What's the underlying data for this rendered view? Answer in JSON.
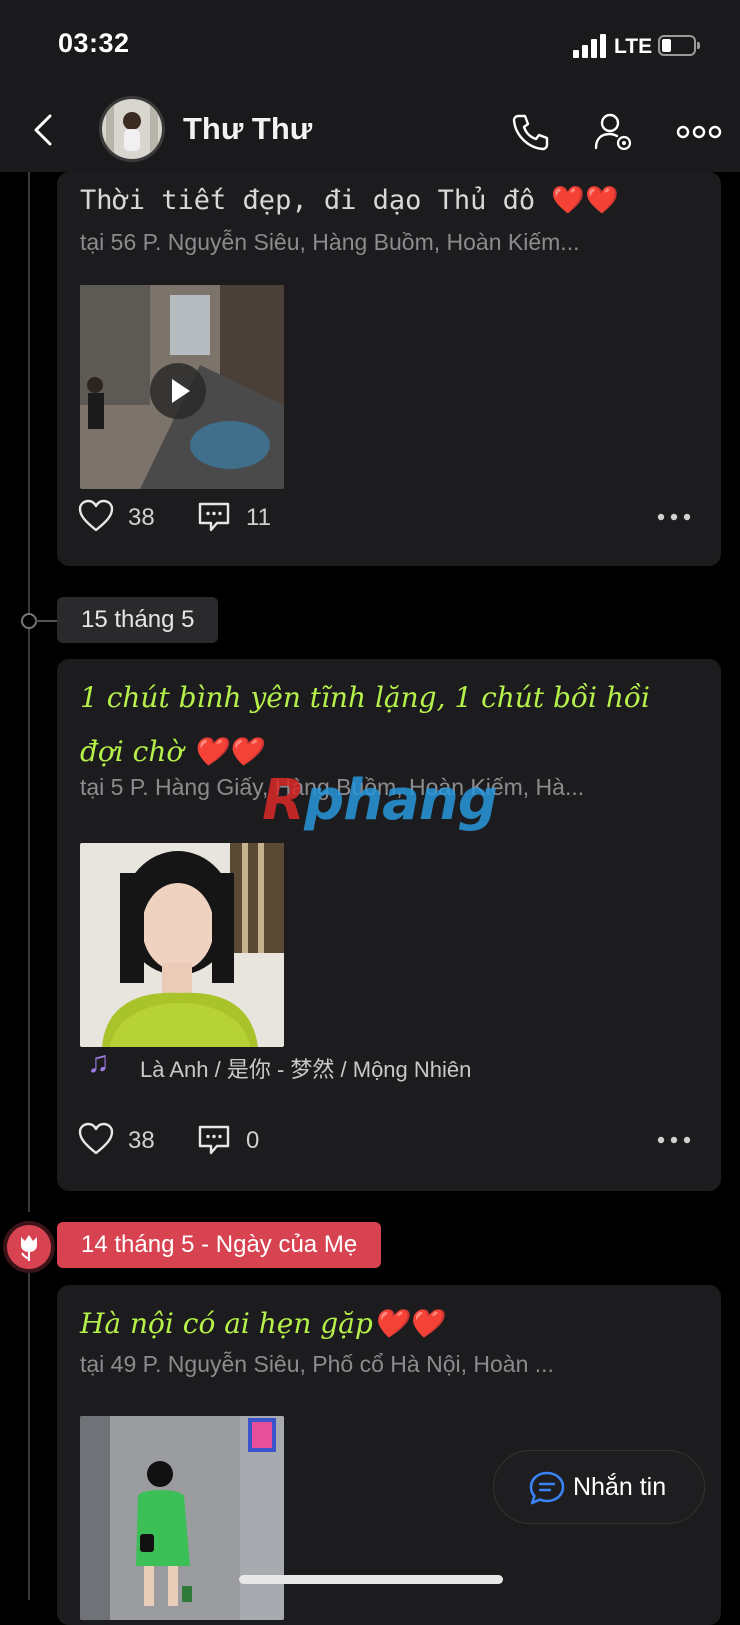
{
  "status_bar": {
    "time": "03:32",
    "network": "LTE",
    "battery_level": 0.2
  },
  "header": {
    "contact_name": "Thư Thư",
    "icons": [
      "back-icon",
      "call-icon",
      "contact-settings-icon",
      "more-icon"
    ]
  },
  "posts": [
    {
      "text": "Thời tiết đẹp, đi dạo Thủ đô ❤️❤️",
      "location": "tại 56 P. Nguyễn Siêu, Hàng Buồm, Hoàn Kiếm...",
      "media_type": "video",
      "likes": "38",
      "comments": "11"
    },
    {
      "date": "15 tháng 5",
      "text": "1 chút bình yên tĩnh lặng, 1 chút bồi hồi đợi chờ ❤️❤️",
      "location": "tại 5 P. Hàng Giấy, Hàng Buồm, Hoàn Kiếm, Hà...",
      "media_type": "photo",
      "music": "Là Anh / 是你 - 梦然 / Mộng Nhiên",
      "likes": "38",
      "comments": "0"
    },
    {
      "date": "14 tháng 5 - Ngày của Mẹ",
      "text": "Hà nội có ai hẹn gặp❤️❤️",
      "location": "tại 49 P. Nguyễn Siêu, Phố cổ Hà Nội, Hoàn ...",
      "media_type": "photo"
    }
  ],
  "watermark": {
    "part1": "R",
    "part2": "phang"
  },
  "message_button": {
    "label": "Nhắn tin"
  },
  "colors": {
    "accent_green": "#b6f04a",
    "holiday_red": "#d84352",
    "background": "#000000",
    "card": "#1c1c1e"
  }
}
